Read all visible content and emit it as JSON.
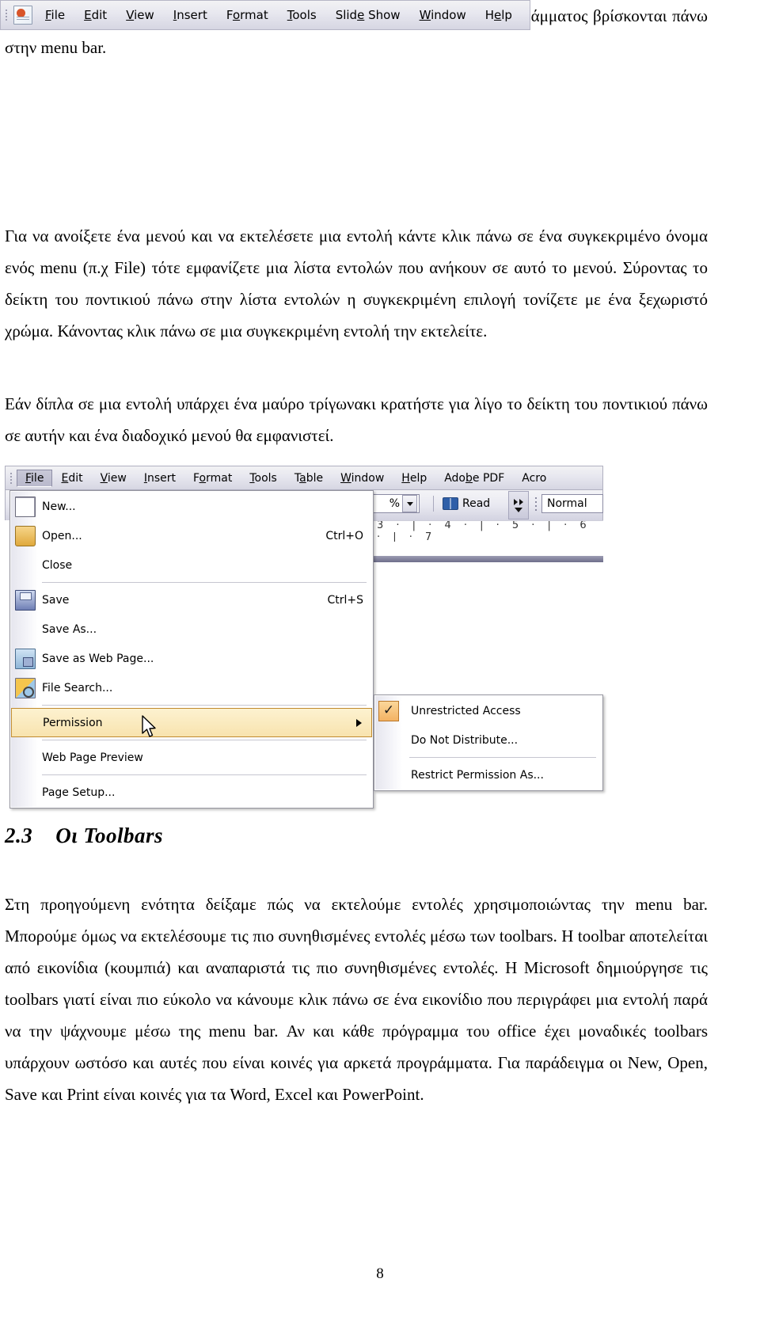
{
  "document": {
    "page_number": "8",
    "paragraphs": {
      "intro": "και δουλεύετε μέσα στο πρόγραμμα σας. Βασικά όλες οι εντολές κάθε προγράμματος βρίσκονται πάνω στην menu bar.",
      "menu_usage": "Για να ανοίξετε ένα μενού και να εκτελέσετε μια εντολή κάντε κλικ πάνω σε ένα συγκεκριμένο όνομα ενός menu (π.χ File) τότε εμφανίζετε μια λίστα εντολών που ανήκουν σε αυτό το μενού. Σύροντας το δείκτη του ποντικιού πάνω στην λίστα εντολών η συγκεκριμένη επιλογή τονίζετε με ένα ξεχωριστό χρώμα. Κάνοντας κλικ πάνω σε μια συγκεκριμένη εντολή την εκτελείτε.",
      "submenu_hint": "Εάν δίπλα σε μια εντολή υπάρχει ένα μαύρο τρίγωνακι κρατήστε για λίγο το δείκτη του ποντικιού πάνω σε αυτήν και ένα διαδοχικό μενού θα εμφανιστεί.",
      "toolbars_body": "Στη προηγούμενη ενότητα δείξαμε πώς να εκτελούμε εντολές χρησιμοποιώντας την menu bar. Μπορούμε όμως να εκτελέσουμε τις πιο συνηθισμένες εντολές μέσω των toolbars. Η toolbar αποτελείται από εικονίδια (κουμπιά) και αναπαριστά τις πιο συνηθισμένες εντολές. Η Microsoft δημιούργησε τις toolbars γιατί είναι πιο εύκολο να κάνουμε κλικ πάνω σε ένα εικονίδιο που περιγράφει μια εντολή παρά να την ψάχνουμε μέσω της menu bar. Αν και κάθε πρόγραμμα του office έχει μοναδικές toolbars υπάρχουν ωστόσο και αυτές που είναι κοινές για αρκετά προγράμματα. Για παράδειγμα οι New, Open, Save και Print είναι κοινές για τα Word, Excel και PowerPoint."
    },
    "heading": {
      "number": "2.3",
      "title": "Οι Toolbars"
    }
  },
  "figures": {
    "word_menubar": {
      "items": [
        "File",
        "Edit",
        "View",
        "Insert",
        "Format",
        "Tools",
        "Table",
        "Window",
        "Help"
      ]
    },
    "powerpoint_menubar": {
      "items": [
        "File",
        "Edit",
        "View",
        "Insert",
        "Format",
        "Tools",
        "Slide Show",
        "Window",
        "Help"
      ]
    },
    "word_file_menu": {
      "menubar": [
        "File",
        "Edit",
        "View",
        "Insert",
        "Format",
        "Tools",
        "Table",
        "Window",
        "Help",
        "Adobe PDF",
        "Acro"
      ],
      "active_menu": "File",
      "toolbar": {
        "zoom_value": "%",
        "read_label": "Read",
        "style_value": "Normal",
        "ruler_ticks": "3  ·  |  ·  4  ·  |  ·  5  ·  |  ·  6  ·  |  ·  7"
      },
      "items": [
        {
          "label": "New...",
          "accel": "",
          "icon": "new-document-icon"
        },
        {
          "label": "Open...",
          "accel": "Ctrl+O",
          "icon": "open-folder-icon"
        },
        {
          "label": "Close",
          "accel": "",
          "icon": ""
        },
        {
          "label": "Save",
          "accel": "Ctrl+S",
          "icon": "floppy-disk-icon"
        },
        {
          "label": "Save As...",
          "accel": "",
          "icon": ""
        },
        {
          "label": "Save as Web Page...",
          "accel": "",
          "icon": "web-page-icon"
        },
        {
          "label": "File Search...",
          "accel": "",
          "icon": "file-search-icon"
        },
        {
          "label": "Permission",
          "accel": "",
          "icon": ""
        },
        {
          "label": "Web Page Preview",
          "accel": "",
          "icon": ""
        },
        {
          "label": "Page Setup...",
          "accel": "",
          "icon": ""
        }
      ],
      "submenu": {
        "items": [
          {
            "label": "Unrestricted Access",
            "checked": true
          },
          {
            "label": "Do Not Distribute...",
            "checked": false
          },
          {
            "label": "Restrict Permission As...",
            "checked": false
          }
        ],
        "check_glyph": "✓"
      },
      "highlight_color": "#f8e3ae",
      "highlight_border": "#c08a2e"
    }
  }
}
